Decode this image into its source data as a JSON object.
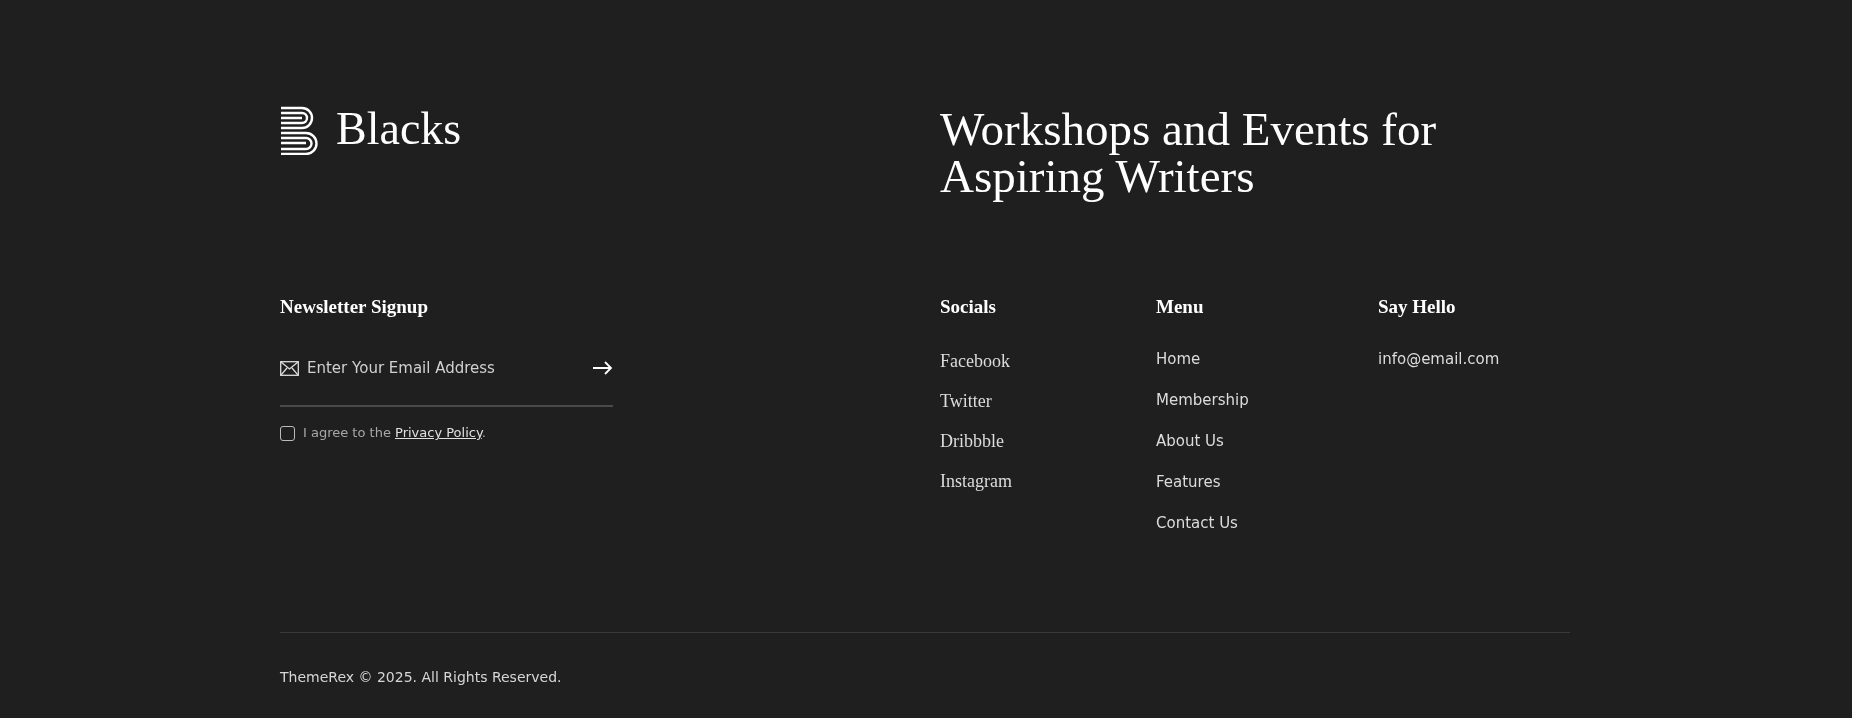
{
  "logo": {
    "text": "Blacks"
  },
  "headline": "Workshops and Events for Aspiring Writers",
  "newsletter": {
    "title": "Newsletter Signup",
    "email": {
      "placeholder": "Enter Your Email Address"
    },
    "consent": {
      "checked": false,
      "text": "I agree to the ",
      "link": "Privacy Policy",
      "after": "."
    }
  },
  "socials": {
    "title": "Socials",
    "items": [
      "Facebook",
      "Twitter",
      "Dribbble",
      "Instagram"
    ]
  },
  "menu": {
    "title": "Menu",
    "items": [
      "Home",
      "Membership",
      "About Us",
      "Features",
      "Contact Us"
    ]
  },
  "contact": {
    "title": "Say Hello",
    "email": "info@email.com"
  },
  "copyright": "ThemeRex © 2025. All Rights Reserved."
}
